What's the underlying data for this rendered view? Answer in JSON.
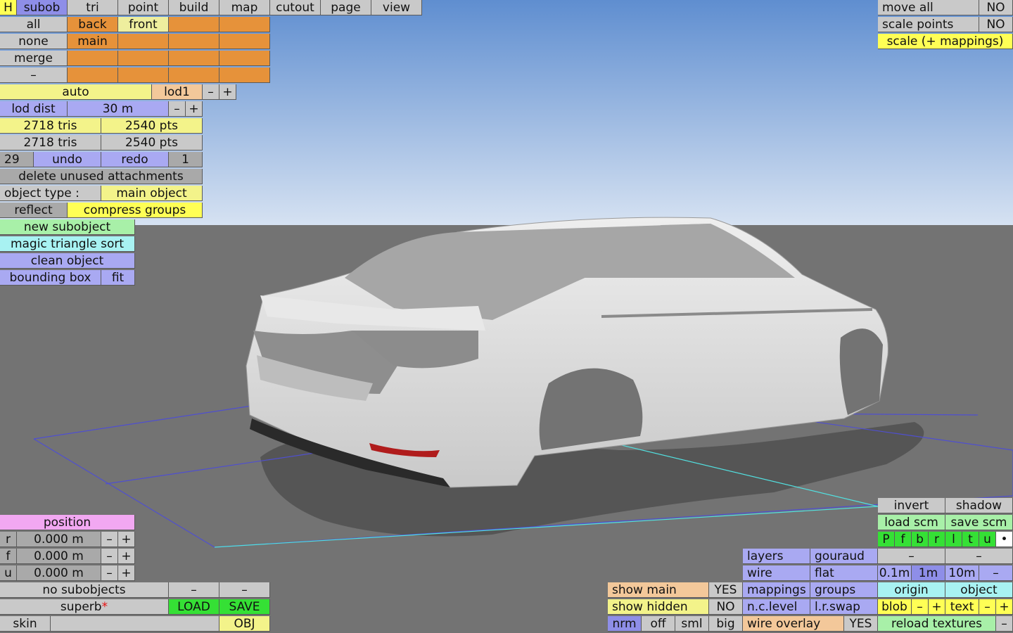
{
  "menu": {
    "h": "H",
    "tabs": [
      "subob",
      "tri",
      "point",
      "build",
      "map",
      "cutout",
      "page",
      "view"
    ]
  },
  "selection": {
    "all": "all",
    "none": "none",
    "merge": "merge",
    "dash": "–",
    "back": "back",
    "front": "front",
    "main": "main"
  },
  "lod": {
    "auto": "auto",
    "name": "lod1",
    "minus": "–",
    "plus": "+",
    "dist_label": "lod dist",
    "dist_value": "30 m"
  },
  "stats": {
    "tris1": "2718 tris",
    "pts1": "2540 pts",
    "tris2": "2718 tris",
    "pts2": "2540 pts"
  },
  "history": {
    "count": "29",
    "undo": "undo",
    "redo": "redo",
    "redo_count": "1"
  },
  "object": {
    "delete_unused": "delete unused attachments",
    "type_label": "object type :",
    "type_value": "main object",
    "reflect": "reflect",
    "compress": "compress groups",
    "new_subobject": "new subobject",
    "magic_sort": "magic triangle sort",
    "clean": "clean object",
    "bounding_box": "bounding box",
    "fit": "fit"
  },
  "top_right": {
    "move_all": "move all",
    "move_all_val": "NO",
    "scale_points": "scale points",
    "scale_points_val": "NO",
    "scale_mappings": "scale (+ mappings)"
  },
  "position": {
    "title": "position",
    "rows": [
      {
        "axis": "r",
        "value": "0.000 m"
      },
      {
        "axis": "f",
        "value": "0.000 m"
      },
      {
        "axis": "u",
        "value": "0.000 m"
      }
    ],
    "minus": "–",
    "plus": "+"
  },
  "bottom_left": {
    "no_subobjects": "no subobjects",
    "dash": "–",
    "name": "superb",
    "star": "*",
    "load": "LOAD",
    "save": "SAVE",
    "skin": "skin",
    "obj": "OBJ"
  },
  "show": {
    "main": "show main",
    "main_val": "YES",
    "hidden": "show hidden",
    "hidden_val": "NO",
    "nrm": "nrm",
    "off": "off",
    "sml": "sml",
    "big": "big"
  },
  "render": {
    "layers": "layers",
    "gouraud": "gouraud",
    "wire": "wire",
    "flat": "flat",
    "mappings": "mappings",
    "groups": "groups",
    "nclevel": "n.c.level",
    "lrswap": "l.r.swap",
    "wire_overlay": "wire overlay",
    "wire_overlay_val": "YES"
  },
  "right_panel": {
    "invert": "invert",
    "shadow": "shadow",
    "load_scm": "load scm",
    "save_scm": "save scm",
    "letters": [
      "P",
      "f",
      "b",
      "r",
      "l",
      "t",
      "u",
      "•"
    ],
    "dash": "–",
    "grid": [
      "0.1m",
      "1m",
      "10m",
      "–"
    ],
    "origin": "origin",
    "object": "object",
    "blob": "blob",
    "minus": "–",
    "plus": "+",
    "text": "text",
    "reload": "reload textures"
  },
  "colors": {
    "sky_top": "#5f8ed0",
    "sky_bottom": "#d6e2f2",
    "ground": "#737373",
    "car_body": "#dedede",
    "taillight": "#b01c1c"
  },
  "icons": {
    "model": "car-3d-model",
    "pivot": "axis-grid"
  }
}
